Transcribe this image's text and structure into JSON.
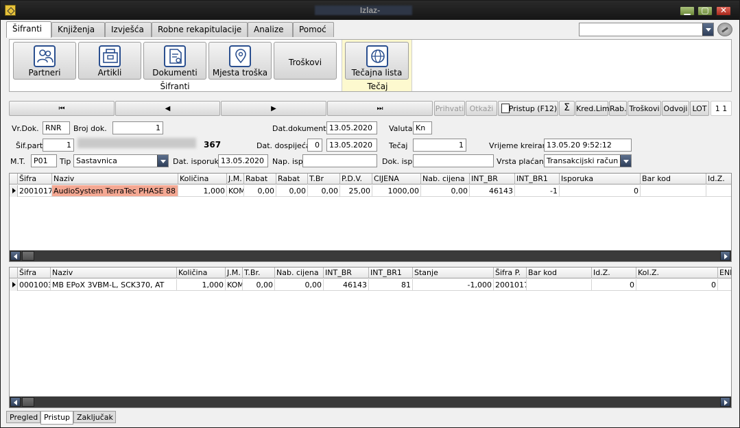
{
  "window": {
    "title": "Izlaz-"
  },
  "tabs": [
    "Šifranti",
    "Knjiženja",
    "Izvješća",
    "Robne rekapitulacije",
    "Analize",
    "Pomoć"
  ],
  "ribbon": {
    "buttons": [
      {
        "label": "Partneri",
        "icon": "partners-icon"
      },
      {
        "label": "Artikli",
        "icon": "articles-icon"
      },
      {
        "label": "Dokumenti",
        "icon": "documents-icon"
      },
      {
        "label": "Mjesta troška",
        "icon": "location-icon"
      },
      {
        "label": "Troškovi",
        "icon": ""
      },
      {
        "label": "Tečajna lista",
        "icon": "globe-icon"
      }
    ],
    "group_sifranti": "Šifranti",
    "group_tecaj": "Tečaj"
  },
  "navbar": {
    "first": "⏮",
    "prev": "◀",
    "next": "▶",
    "last": "⏭",
    "prihvati": "Prihvati",
    "otkazi": "Otkaži",
    "pristup": "Pristup (F12)",
    "sigma": "Σ",
    "kredlim": "Kred.Lim",
    "rab": "Rab.",
    "troskovi": "Troškovi",
    "odvoji": "Odvoji",
    "lot": "LOT",
    "counter": "1 1"
  },
  "form": {
    "vrdok_label": "Vr.Dok.",
    "vrdok": "RNR",
    "brojdok_label": "Broj dok.",
    "brojdok": "1",
    "datdok_label": "Dat.dokumenta",
    "datdok": "13.05.2020",
    "valuta_label": "Valuta",
    "valuta": "Kn",
    "sifpart_label": "Šif.part.",
    "sifpart": "1",
    "partnum": "367",
    "datdosp_label": "Dat. dospijeća",
    "dospdays": "0",
    "datdosp": "13.05.2020",
    "tecaj_label": "Tečaj",
    "tecaj": "1",
    "vrijeme_label": "Vrijeme kreiranja",
    "vrijeme": "13.05.20 9:52:12",
    "mt_label": "M.T.",
    "mt": "P01",
    "tip_label": "Tip",
    "tip": "Sastavnica",
    "datisp_label": "Dat. isporuke",
    "datisp": "13.05.2020",
    "napisp_label": "Nap. isp.",
    "napisp": "",
    "dokisp_label": "Dok. isp.",
    "dokisp": "",
    "vrstaplacanja_label": "Vrsta plaćanja",
    "vrstaplacanja": "Transakcijski račun"
  },
  "grid1": {
    "headers": [
      "Šifra",
      "Naziv",
      "Količina",
      "J.M.",
      "Rabat",
      "Rabat",
      "T.Br",
      "P.D.V.",
      "CIJENA",
      "Nab. cijena",
      "INT_BR",
      "INT_BR1",
      "Isporuka",
      "Bar kod",
      "Id.Z."
    ],
    "rows": [
      [
        "2001017",
        "AudioSystem TerraTec PHASE 88",
        "1,000",
        "KOM",
        "0,00",
        "0,00",
        "0,00",
        "25,00",
        "1000,00",
        "0,00",
        "46143",
        "-1",
        "0",
        "",
        ""
      ]
    ]
  },
  "grid2": {
    "headers": [
      "Šifra",
      "Naziv",
      "Količina",
      "J.M.",
      "T.Br.",
      "Nab. cijena",
      "INT_BR",
      "INT_BR1",
      "Stanje",
      "Šifra P.",
      "Bar kod",
      "Id.Z.",
      "Kol.Z.",
      "ENI"
    ],
    "rows": [
      [
        "0001003",
        "MB EPoX 3VBM-L, SCK370, AT",
        "1,000",
        "KOM",
        "0,00",
        "0,00",
        "46143",
        "81",
        "-1,000",
        "2001017",
        "",
        "0",
        "0",
        ""
      ]
    ]
  },
  "bottom_tabs": [
    "Pregled",
    "Pristup",
    "Zaključak"
  ],
  "colors": {
    "highlight": "#f4a893",
    "tecaj_bg": "#fdf9cf"
  }
}
